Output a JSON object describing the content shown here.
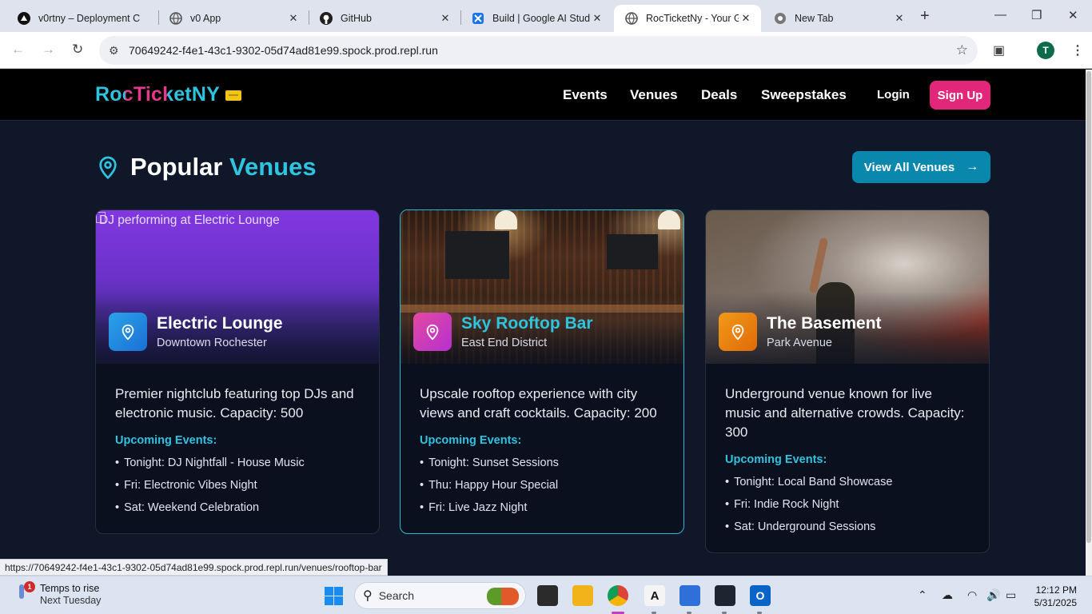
{
  "browser": {
    "tabs": [
      {
        "title": "v0rtny – Deployment C",
        "active": false
      },
      {
        "title": "v0 App",
        "active": false
      },
      {
        "title": "GitHub",
        "active": false
      },
      {
        "title": "Build | Google AI Studi",
        "active": false
      },
      {
        "title": "RocTicketNy - Your Ga",
        "active": true
      },
      {
        "title": "New Tab",
        "active": false
      }
    ],
    "url": "70649242-f4e1-43c1-9302-05d74ad81e99.spock.prod.repl.run",
    "profile_initial": "T",
    "status_url": "https://70649242-f4e1-43c1-9302-05d74ad81e99.spock.prod.repl.run/venues/rooftop-bar"
  },
  "site": {
    "logo": "RocTicketNY",
    "nav": [
      "Events",
      "Venues",
      "Deals",
      "Sweepstakes"
    ],
    "login": "Login",
    "signup": "Sign Up",
    "section_title_main": "Popular",
    "section_title_accent": "Venues",
    "view_all": "View All Venues",
    "upcoming_label": "Upcoming Events:",
    "venues": [
      {
        "name": "Electric Lounge",
        "location": "Downtown Rochester",
        "image_alt": "DJ performing at Electric Lounge",
        "description": "Premier nightclub featuring top DJs and electronic music. Capacity: 500",
        "events": [
          "Tonight: DJ Nightfall - House Music",
          "Fri: Electronic Vibes Night",
          "Sat: Weekend Celebration"
        ]
      },
      {
        "name": "Sky Rooftop Bar",
        "location": "East End District",
        "description": "Upscale rooftop experience with city views and craft cocktails. Capacity: 200",
        "events": [
          "Tonight: Sunset Sessions",
          "Thu: Happy Hour Special",
          "Fri: Live Jazz Night"
        ]
      },
      {
        "name": "The Basement",
        "location": "Park Avenue",
        "description": "Underground venue known for live music and alternative crowds. Capacity: 300",
        "events": [
          "Tonight: Local Band Showcase",
          "Fri: Indie Rock Night",
          "Sat: Underground Sessions"
        ]
      }
    ]
  },
  "taskbar": {
    "weather_title": "Temps to rise",
    "weather_sub": "Next Tuesday",
    "weather_badge": "1",
    "search_placeholder": "Search",
    "time": "12:12 PM",
    "date": "5/31/2025"
  },
  "colors": {
    "accent": "#2ec4e0",
    "brand_pink": "#e2267a",
    "view_all": "#0a87ad",
    "page_bg": "#101728"
  }
}
